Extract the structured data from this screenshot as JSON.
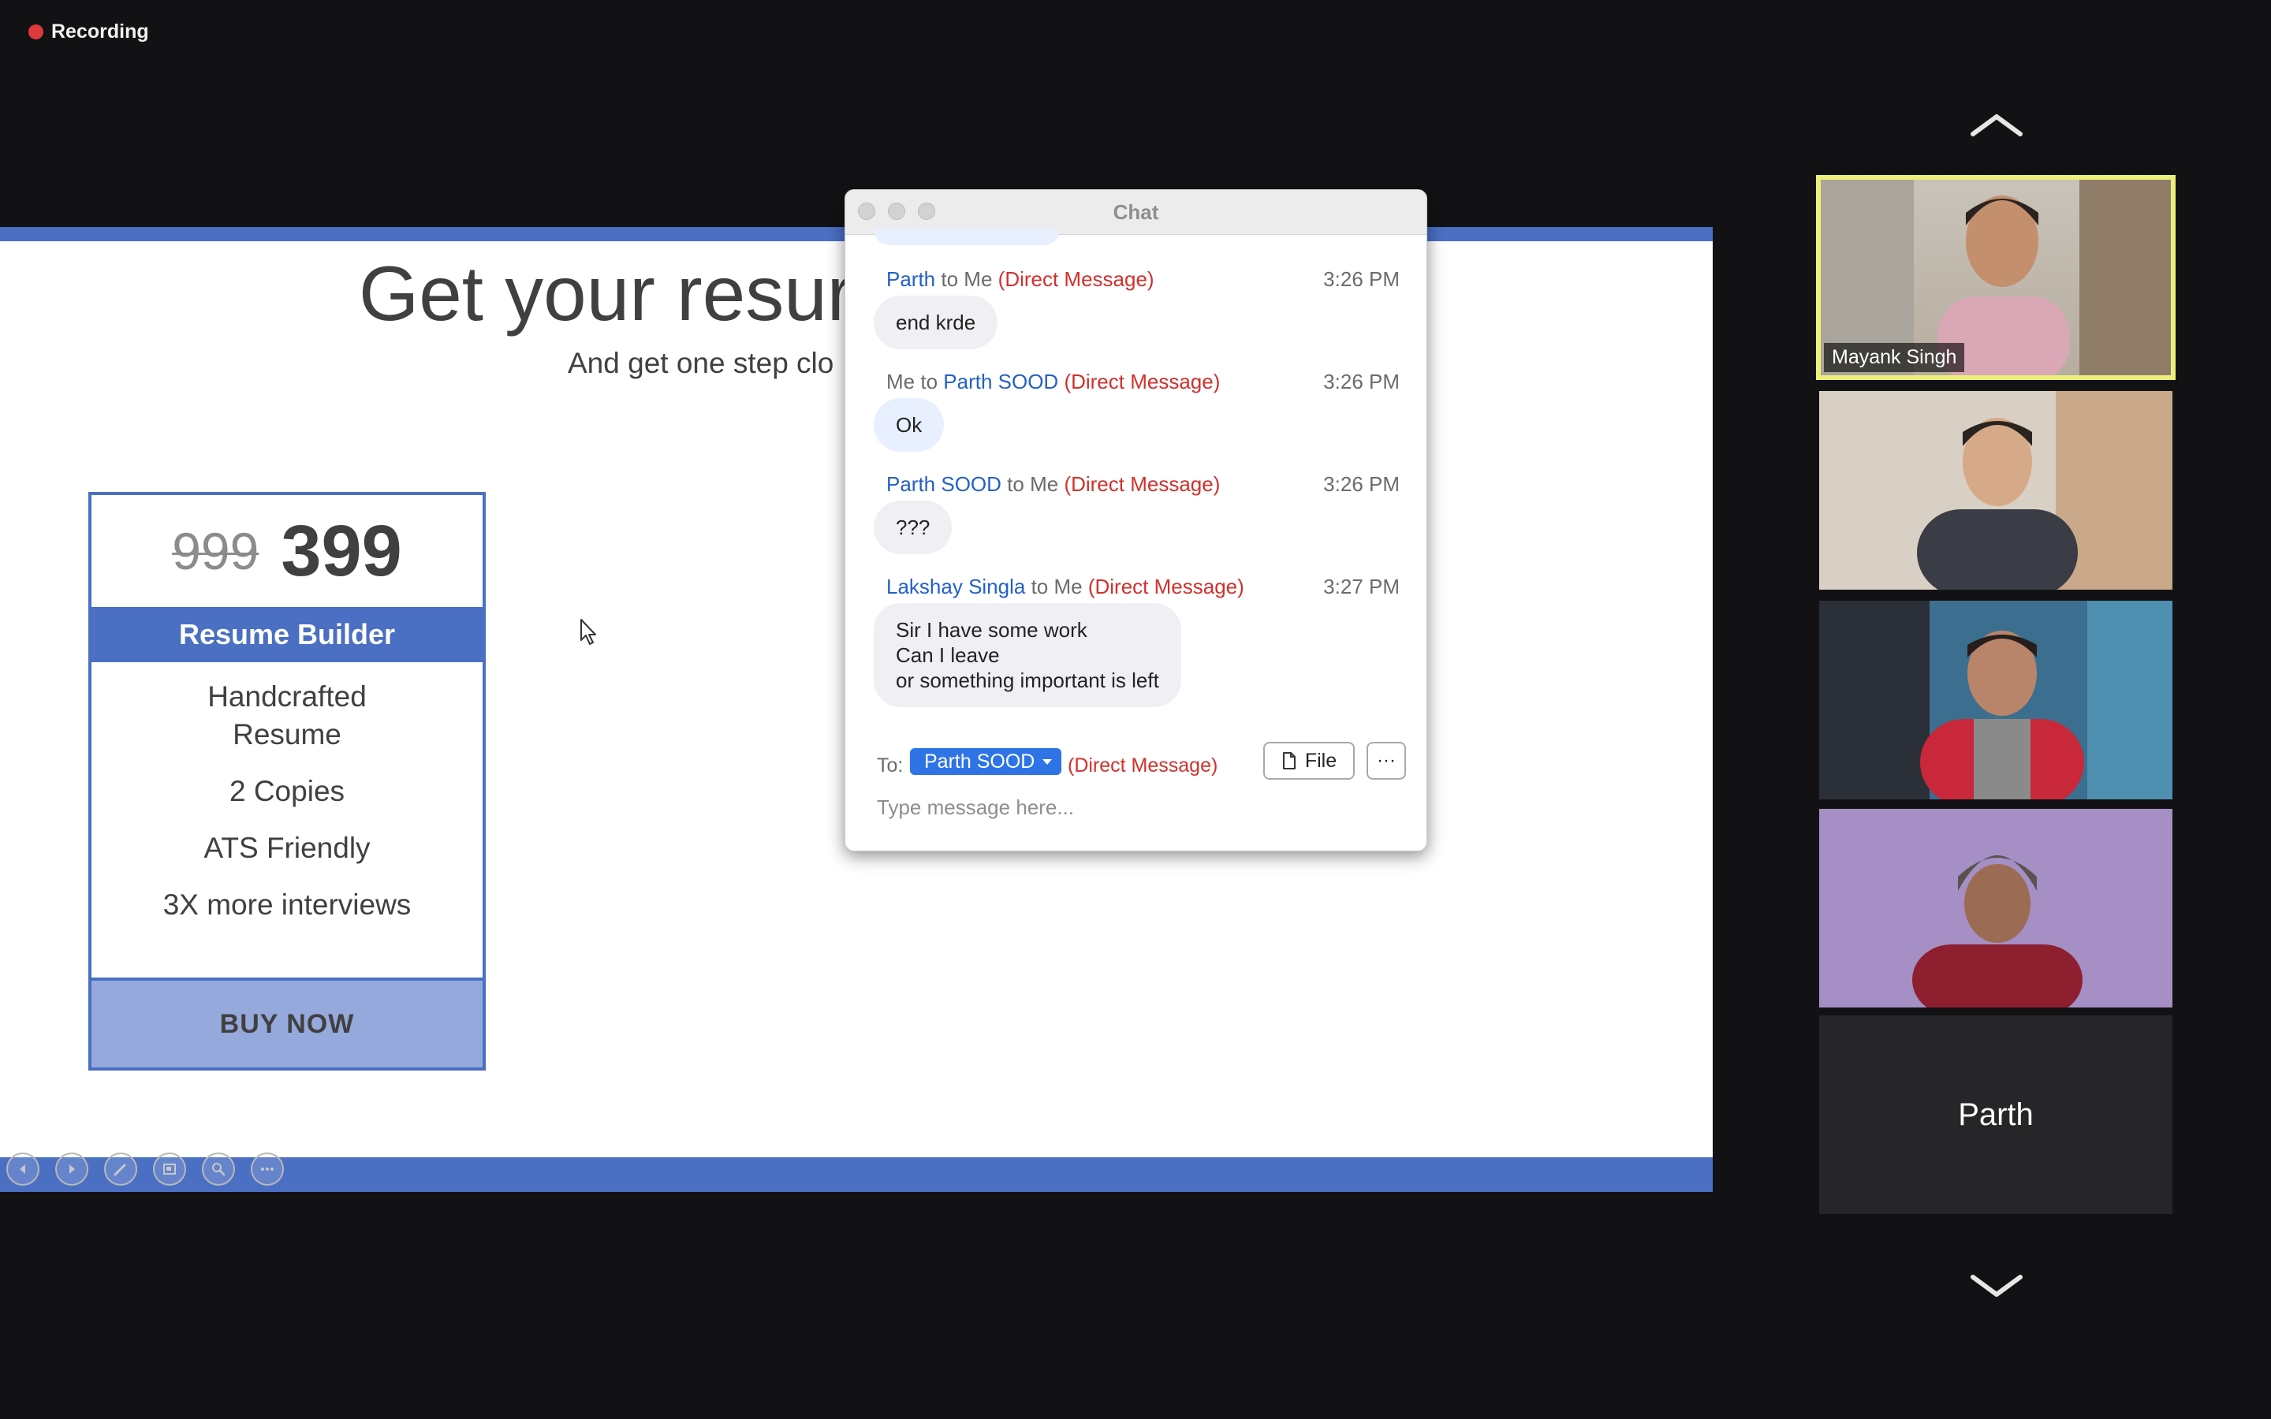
{
  "recording": {
    "label": "Recording"
  },
  "slide": {
    "title": "Get your resur",
    "subtitle": "And get one step clo",
    "card": {
      "old_price": "999",
      "new_price": "399",
      "header": "Resume Builder",
      "features": [
        "Handcrafted Resume",
        "2 Copies",
        "ATS Friendly",
        "3X more interviews"
      ],
      "cta": "BUY NOW"
    },
    "tools": [
      "prev-icon",
      "next-icon",
      "pen-icon",
      "layout-icon",
      "zoom-icon",
      "more-icon"
    ]
  },
  "chat": {
    "title": "Chat",
    "messages": [
      {
        "from": "Parth",
        "to": "to Me",
        "tag": "(Direct Message)",
        "time": "3:26 PM",
        "text": "end krde"
      },
      {
        "from": "Me to",
        "to": "Parth SOOD",
        "tag": "(Direct Message)",
        "time": "3:26 PM",
        "text": "Ok"
      },
      {
        "from": "Parth SOOD",
        "to": "to Me",
        "tag": "(Direct Message)",
        "time": "3:26 PM",
        "text": "???"
      },
      {
        "from": "Lakshay Singla",
        "to": "to Me",
        "tag": "(Direct Message)",
        "time": "3:27 PM",
        "text": "Sir I have some work\nCan I leave\nor something important is left"
      }
    ],
    "compose": {
      "to_label": "To:",
      "recipient": "Parth SOOD",
      "recipient_tag": "(Direct Message)",
      "file_label": "File",
      "more_label": "···",
      "placeholder": "Type message here..."
    }
  },
  "participants": [
    {
      "name": "Mayank Singh",
      "active": true
    },
    {
      "name": "",
      "active": false
    },
    {
      "name": "",
      "active": false
    },
    {
      "name": "",
      "active": false
    },
    {
      "name": "Parth",
      "video": false
    }
  ],
  "colors": {
    "accent": "#4a6fc3",
    "recording": "#e0393b",
    "active_speaker": "#ecf07a",
    "chat_name": "#2460c8",
    "direct_message": "#d0312d"
  }
}
